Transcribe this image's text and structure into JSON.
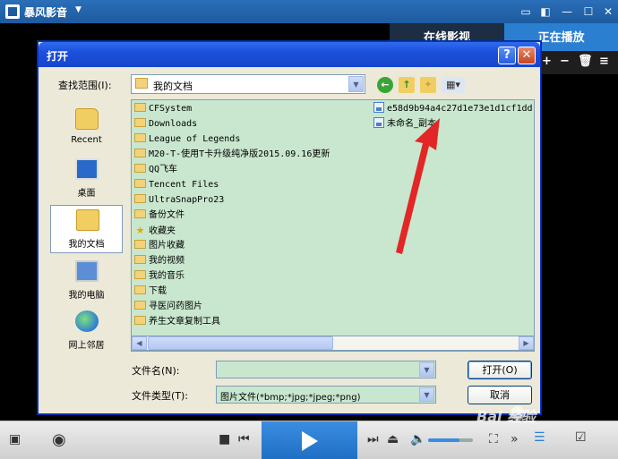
{
  "player": {
    "title": "暴风影音",
    "tabs": [
      "在线影视",
      "正在播放"
    ]
  },
  "dialog": {
    "title": "打开",
    "help_glyph": "?",
    "close_glyph": "✕",
    "look_in_label": "查找范围(I):",
    "look_in_value": "我的文档",
    "places": [
      "Recent",
      "桌面",
      "我的文档",
      "我的电脑",
      "网上邻居"
    ],
    "folders": [
      "CFSystem",
      "Downloads",
      "League of Legends",
      "M20-T-使用T卡升级纯净版2015.09.16更新",
      "QQ飞车",
      "Tencent Files",
      "UltraSnapPro23",
      "备份文件",
      "收藏夹",
      "图片收藏",
      "我的视频",
      "我的音乐",
      "下载",
      "寻医问药图片",
      "养生文章复制工具"
    ],
    "files": [
      "e58d9b94a4c27d1e73e1d1cf1dd",
      "未命名_副本"
    ],
    "filename_label": "文件名(N):",
    "filename_value": "",
    "filetype_label": "文件类型(T):",
    "filetype_value": "图片文件(*bmp;*jpg;*jpeg;*png)",
    "open_label": "打开(O)",
    "cancel_label": "取消"
  },
  "controls": {
    "volume_fraction": 0.7
  },
  "watermark": "Bai 经验",
  "colors": {
    "accent": "#2b7fd1",
    "list_bg": "#c9e7ce",
    "annotation": "#e32626"
  }
}
